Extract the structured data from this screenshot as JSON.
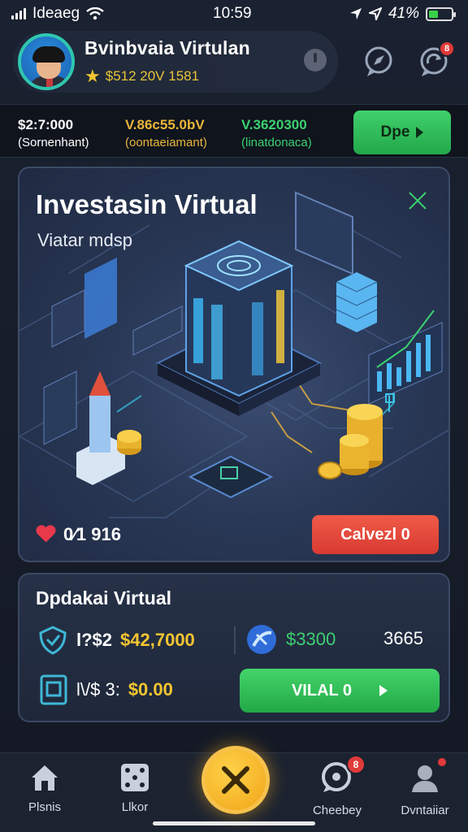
{
  "status_bar": {
    "carrier": "Ideaeg",
    "time": "10:59",
    "battery": "41%",
    "battery_level": 0.41
  },
  "header": {
    "title": "Bvinbvaia Virtulan",
    "stat_text": "$512 20V 1581",
    "icons": [
      "power-icon",
      "compass-chat-icon",
      "refresh-chat-icon"
    ],
    "notification_badge": "8"
  },
  "stats": [
    {
      "value": "$2:7:000",
      "sub": "(Sornenhant)",
      "color": "#ffffff"
    },
    {
      "value": "V.86c55.0bV",
      "sub": "(oontaeiamant)",
      "color": "#e9b63a"
    },
    {
      "value": "V.3620300",
      "sub": "(linatdonaca)",
      "color": "#3cd070"
    }
  ],
  "open_button": {
    "label": "Dpe"
  },
  "hero": {
    "title": "Investasin Virtual",
    "subtitle": "Viatar mdsp",
    "likes": "0⁄1 916",
    "cancel_label": "Calvezl 0"
  },
  "info": {
    "title": "Dpdakai Virtual",
    "row1_prefix": "l?$2",
    "row1_value": "$42,7000",
    "row1_mid": "$3300",
    "row1_right": "3665",
    "row2_prefix": "l\\/$ 3:",
    "row2_value": "$0.00",
    "view_label": "VILAL 0"
  },
  "nav": {
    "items": [
      {
        "label": "Plsnis",
        "icon": "home-icon"
      },
      {
        "label": "Llkor",
        "icon": "dice-icon"
      },
      {
        "label": "Cheebey",
        "icon": "chat-icon"
      },
      {
        "label": "Dvntaiiar",
        "icon": "profile-icon"
      }
    ],
    "chat_badge": "8"
  },
  "colors": {
    "accent_green": "#2fb954",
    "accent_red": "#e0473b",
    "gold": "#f4c531",
    "teal": "#2fc7b0"
  }
}
